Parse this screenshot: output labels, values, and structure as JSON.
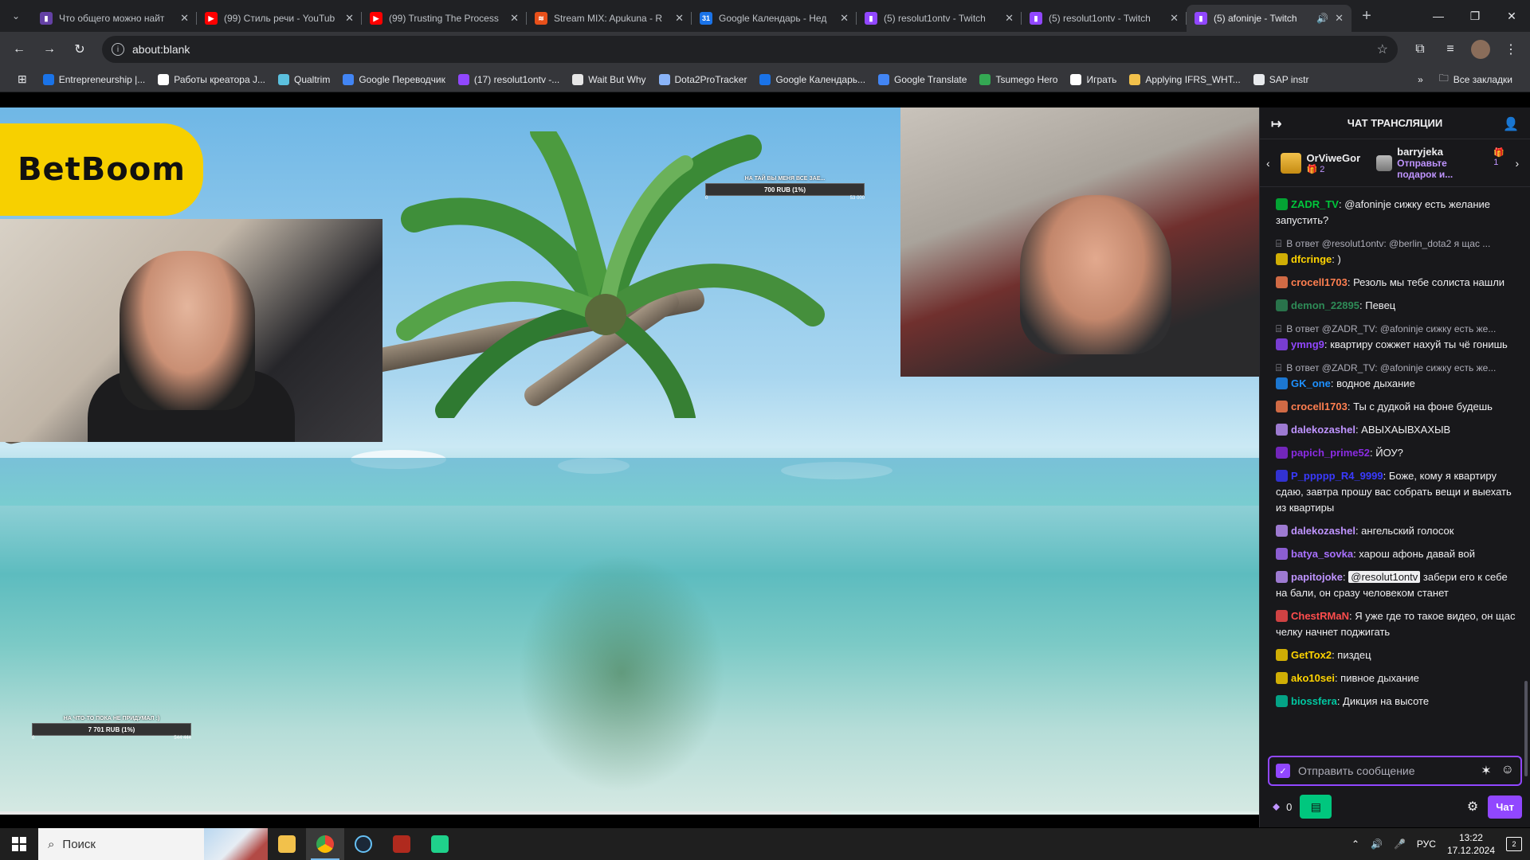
{
  "browser": {
    "tabs": [
      {
        "title": "Что общего можно найт",
        "fav_color": "#6441a5",
        "fav_glyph": "▮"
      },
      {
        "title": "(99) Стиль речи - YouTub",
        "fav_color": "#ff0000",
        "fav_glyph": "▶"
      },
      {
        "title": "(99) Trusting The Process",
        "fav_color": "#ff0000",
        "fav_glyph": "▶"
      },
      {
        "title": "Stream MIX: Apukuna - R",
        "fav_color": "#e8501a",
        "fav_glyph": "≋"
      },
      {
        "title": "Google Календарь - Нед",
        "fav_color": "#1a73e8",
        "fav_glyph": "31"
      },
      {
        "title": "(5) resolut1ontv - Twitch",
        "fav_color": "#9147ff",
        "fav_glyph": "▮"
      },
      {
        "title": "(5) resolut1ontv - Twitch",
        "fav_color": "#9147ff",
        "fav_glyph": "▮"
      },
      {
        "title": "(5) afoninje - Twitch",
        "fav_color": "#9147ff",
        "fav_glyph": "▮",
        "active": true
      }
    ],
    "address": "about:blank",
    "bookmarks": [
      {
        "label": "Entrepreneurship |...",
        "color": "#1a73e8"
      },
      {
        "label": "Работы креатора J...",
        "color": "#ffffff"
      },
      {
        "label": "Qualtrim",
        "color": "#5bc0de"
      },
      {
        "label": "Google Переводчик",
        "color": "#4285f4"
      },
      {
        "label": "(17) resolut1ontv -...",
        "color": "#9147ff"
      },
      {
        "label": "Wait But Why",
        "color": "#e6e6e6"
      },
      {
        "label": "Dota2ProTracker",
        "color": "#8ab4f8"
      },
      {
        "label": "Google Календарь...",
        "color": "#1a73e8"
      },
      {
        "label": "Google Translate",
        "color": "#4285f4"
      },
      {
        "label": "Tsumego Hero",
        "color": "#34a853"
      },
      {
        "label": "Играть",
        "color": "#ffffff"
      },
      {
        "label": "Applying IFRS_WHT...",
        "color": "#f2c14b"
      },
      {
        "label": "SAP instr",
        "color": "#e8eaed"
      }
    ],
    "all_bookmarks": "Все закладки"
  },
  "stream": {
    "sponsor": "BetBoom",
    "donation_top": {
      "title": "НА ТАЙ ВЫ МЕНЯ ВСЕ ЗАЕ...",
      "amount": "700 RUB (1%)",
      "left": "0",
      "right": "53 000"
    },
    "donation_bottom": {
      "title": "НА ЧТО-ТО ПОКА НЕ ПРИДУМАЛ :)",
      "amount": "7 701 RUB (1%)",
      "left": "0",
      "right": "544 444"
    },
    "progress": 0.66
  },
  "chat": {
    "header": "ЧАТ ТРАНСЛЯЦИИ",
    "gifters": [
      {
        "name": "OrViweGor",
        "count": "2"
      },
      {
        "name": "barryjeka",
        "count": "1",
        "message": "Отправьте подарок и..."
      }
    ],
    "messages": [
      {
        "user": "ZADR_TV",
        "color": "#00c73b",
        "text": "@afoninje сижку есть желание запустить?"
      },
      {
        "reply": "В ответ @resolut1ontv: @berlin_dota2 я щас ...",
        "user": "dfcringe",
        "color": "#ffd400",
        "text": ")"
      },
      {
        "user": "crocell1703",
        "color": "#ff7f50",
        "text": "Резоль мы тебе солиста нашли"
      },
      {
        "user": "demon_22895",
        "color": "#2e8b57",
        "text": "Певец"
      },
      {
        "reply": "В ответ @ZADR_TV: @afoninje сижку есть же...",
        "user": "ymng9",
        "color": "#9147ff",
        "text": "квартиру сожжет нахуй ты чё гонишь"
      },
      {
        "reply": "В ответ @ZADR_TV: @afoninje сижку есть же...",
        "user": "GK_one",
        "color": "#1e90ff",
        "text": "водное дыхание"
      },
      {
        "user": "crocell1703",
        "color": "#ff7f50",
        "text": "Ты с дудкой на фоне будешь"
      },
      {
        "user": "dalekozashel",
        "color": "#bf94ff",
        "text": "АВЫХАЫВХАХЫВ"
      },
      {
        "user": "papich_prime52",
        "color": "#8a2be2",
        "text": "ЙОУ?"
      },
      {
        "user": "P_ppppp_R4_9999",
        "color": "#3a3aff",
        "text": "Боже, кому я квартиру сдаю, завтра прошу вас собрать вещи и выехать из квартиры"
      },
      {
        "user": "dalekozashel",
        "color": "#bf94ff",
        "text": "ангельский голосок"
      },
      {
        "user": "batya_sovka",
        "color": "#a970ff",
        "text": "харош афонь давай вой"
      },
      {
        "user": "papitojoke",
        "color": "#bf94ff",
        "mention": "@resolut1ontv",
        "text": "забери его к себе на бали, он сразу человеком станет"
      },
      {
        "user": "ChestRMaN",
        "color": "#ff4d4d",
        "text": "Я уже где то такое видео, он щас челку начнет поджигать"
      },
      {
        "user": "GetTox2",
        "color": "#ffd400",
        "text": "пиздец"
      },
      {
        "user": "ako10sei",
        "color": "#ffd400",
        "text": "пивное дыхание"
      },
      {
        "user": "biossfera",
        "color": "#00c7a1",
        "text": "Дикция на высоте"
      }
    ],
    "input_placeholder": "Отправить сообщение",
    "points": "0",
    "chat_button": "Чат"
  },
  "taskbar": {
    "search_placeholder": "Поиск",
    "lang": "РУС",
    "time": "13:22",
    "date": "17.12.2024",
    "notifications": "2"
  }
}
